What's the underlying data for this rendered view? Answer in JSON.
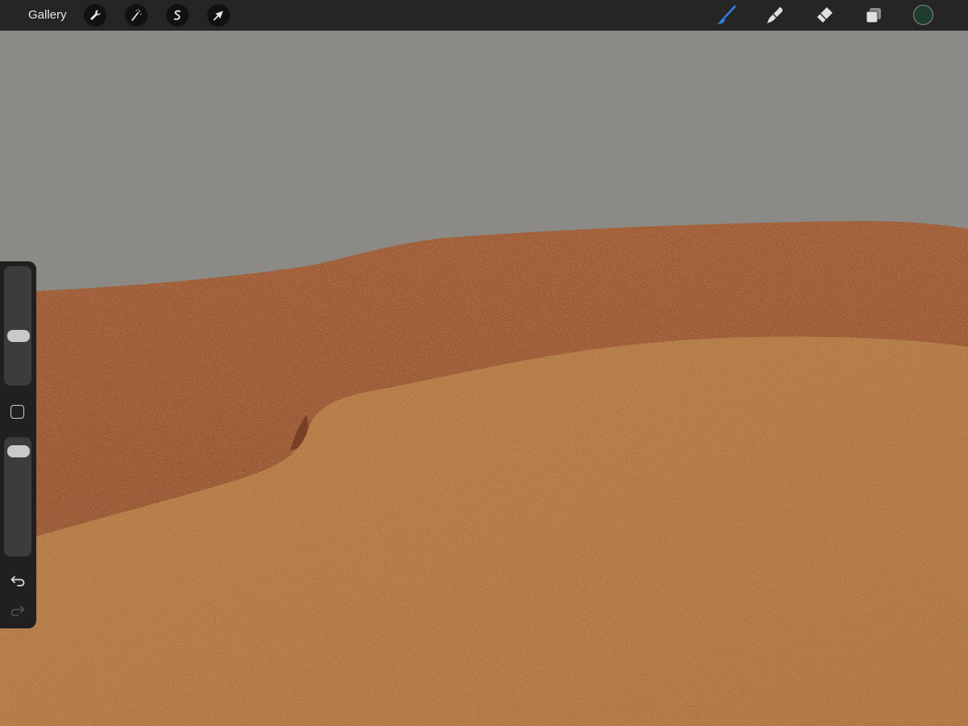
{
  "toolbar": {
    "gallery_label": "Gallery",
    "left_tools": [
      {
        "name": "actions",
        "icon": "wrench-icon"
      },
      {
        "name": "adjustments",
        "icon": "magic-wand-icon"
      },
      {
        "name": "selection",
        "icon": "selection-s-icon"
      },
      {
        "name": "transform",
        "icon": "arrow-cursor-icon"
      }
    ],
    "right_tools": [
      {
        "name": "brush",
        "icon": "brush-icon",
        "active": true
      },
      {
        "name": "smudge",
        "icon": "smudge-icon",
        "active": false
      },
      {
        "name": "eraser",
        "icon": "eraser-icon",
        "active": false
      },
      {
        "name": "layers",
        "icon": "layers-icon",
        "active": false
      }
    ],
    "current_color": "#1f3d2b",
    "active_color": "#2f7de1"
  },
  "sidebar": {
    "brush_size_level": 0.4,
    "opacity_level": 0.95,
    "modify_button": "square-button",
    "undo_icon": "undo-icon",
    "redo_icon": "redo-icon"
  },
  "canvas": {
    "sky_color": "#8b8a86",
    "back_dune_color": "#98532e",
    "front_dune_color": "#b8793f"
  }
}
